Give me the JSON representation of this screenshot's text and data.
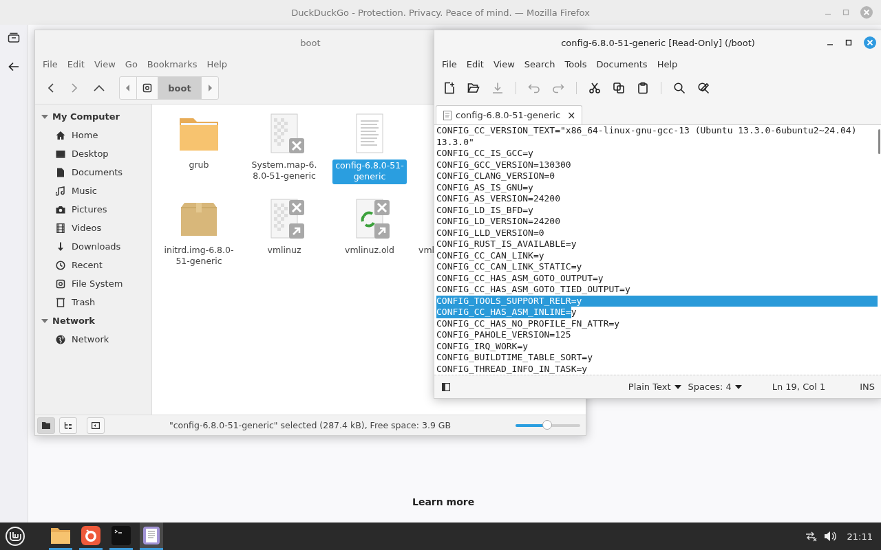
{
  "browser": {
    "title": "DuckDuckGo - Protection. Privacy. Peace of mind. — Mozilla Firefox",
    "learn_more": "Learn more"
  },
  "file_manager": {
    "title": "boot",
    "menu": [
      "File",
      "Edit",
      "View",
      "Go",
      "Bookmarks",
      "Help"
    ],
    "path": [
      {
        "kind": "drive",
        "selected": false
      },
      {
        "kind": "folder",
        "label": "boot",
        "selected": true
      }
    ],
    "sidebar": [
      {
        "label": "My Computer",
        "expanded": true,
        "children": [
          {
            "label": "Home",
            "kind": "home"
          },
          {
            "label": "Desktop",
            "kind": "desktop"
          },
          {
            "label": "Documents",
            "kind": "document"
          },
          {
            "label": "Music",
            "kind": "music"
          },
          {
            "label": "Pictures",
            "kind": "camera"
          },
          {
            "label": "Videos",
            "kind": "film"
          },
          {
            "label": "Downloads",
            "kind": "download"
          },
          {
            "label": "Recent",
            "kind": "clock"
          },
          {
            "label": "File System",
            "kind": "drive"
          },
          {
            "label": "Trash",
            "kind": "trash"
          }
        ]
      },
      {
        "label": "Network",
        "expanded": true,
        "children": [
          {
            "label": "Network",
            "kind": "globe"
          }
        ]
      }
    ],
    "files": [
      {
        "name": "grub",
        "kind": "folder",
        "selected": false
      },
      {
        "name": "System.map-6.8.0-51-generic",
        "kind": "broken",
        "selected": false
      },
      {
        "name": "config-6.8.0-51-generic",
        "kind": "text",
        "selected": true
      },
      {
        "name": "initrd.img-6.8.0-51-generic",
        "kind": "package",
        "selected": false
      },
      {
        "name": "vmlinuz",
        "kind": "broken-link",
        "selected": false
      },
      {
        "name": "vmlinuz.old",
        "kind": "recycle-link",
        "selected": false
      },
      {
        "name": "vml",
        "kind": "covered",
        "selected": false
      }
    ],
    "status": "\"config-6.8.0-51-generic\" selected (287.4 kB), Free space: 3.9 GB",
    "zoom": {
      "level": 0.49
    }
  },
  "editor": {
    "title": "config-6.8.0-51-generic [Read-Only] (/boot)",
    "menu": [
      "File",
      "Edit",
      "View",
      "Search",
      "Tools",
      "Documents",
      "Help"
    ],
    "toolbar": [
      {
        "kind": "new",
        "disabled": false
      },
      {
        "kind": "open",
        "disabled": false
      },
      {
        "kind": "save",
        "disabled": true
      },
      {
        "kind": "sep"
      },
      {
        "kind": "undo",
        "disabled": true
      },
      {
        "kind": "redo",
        "disabled": true
      },
      {
        "kind": "sep"
      },
      {
        "kind": "cut",
        "disabled": false
      },
      {
        "kind": "copy",
        "disabled": false
      },
      {
        "kind": "paste",
        "disabled": false
      },
      {
        "kind": "sep"
      },
      {
        "kind": "search",
        "disabled": false
      },
      {
        "kind": "replace",
        "disabled": false
      }
    ],
    "tab": {
      "label": "config-6.8.0-51-generic",
      "close": "×"
    },
    "lines": [
      {
        "segments": [
          {
            "text": "CONFIG_CC_VERSION_TEXT=\"x86_64-linux-gnu-gcc-13 (Ubuntu 13.3.0-6ubuntu2~24.04)",
            "selected": false
          }
        ],
        "eol_selected": false
      },
      {
        "segments": [
          {
            "text": "13.3.0\"",
            "selected": false
          }
        ],
        "eol_selected": false
      },
      {
        "segments": [
          {
            "text": "CONFIG_CC_IS_GCC=y",
            "selected": false
          }
        ],
        "eol_selected": false
      },
      {
        "segments": [
          {
            "text": "CONFIG_GCC_VERSION=130300",
            "selected": false
          }
        ],
        "eol_selected": false
      },
      {
        "segments": [
          {
            "text": "CONFIG_CLANG_VERSION=0",
            "selected": false
          }
        ],
        "eol_selected": false
      },
      {
        "segments": [
          {
            "text": "CONFIG_AS_IS_GNU=y",
            "selected": false
          }
        ],
        "eol_selected": false
      },
      {
        "segments": [
          {
            "text": "CONFIG_AS_VERSION=24200",
            "selected": false
          }
        ],
        "eol_selected": false
      },
      {
        "segments": [
          {
            "text": "CONFIG_LD_IS_BFD=y",
            "selected": false
          }
        ],
        "eol_selected": false
      },
      {
        "segments": [
          {
            "text": "CONFIG_LD_VERSION=24200",
            "selected": false
          }
        ],
        "eol_selected": false
      },
      {
        "segments": [
          {
            "text": "CONFIG_LLD_VERSION=0",
            "selected": false
          }
        ],
        "eol_selected": false
      },
      {
        "segments": [
          {
            "text": "CONFIG_RUST_IS_AVAILABLE=y",
            "selected": false
          }
        ],
        "eol_selected": false
      },
      {
        "segments": [
          {
            "text": "CONFIG_CC_CAN_LINK=y",
            "selected": false
          }
        ],
        "eol_selected": false
      },
      {
        "segments": [
          {
            "text": "CONFIG_CC_CAN_LINK_STATIC=y",
            "selected": false
          }
        ],
        "eol_selected": false
      },
      {
        "segments": [
          {
            "text": "CONFIG_CC_HAS_ASM_GOTO_OUTPUT=y",
            "selected": false
          }
        ],
        "eol_selected": false
      },
      {
        "segments": [
          {
            "text": "CONFIG_CC_HAS_ASM_GOTO_TIED_OUTPUT=y",
            "selected": false
          }
        ],
        "eol_selected": false
      },
      {
        "segments": [
          {
            "text": "CONFIG_TOOLS_SUPPORT_RELR=y",
            "selected": true
          }
        ],
        "eol_selected": true
      },
      {
        "segments": [
          {
            "text": "CONFIG_CC_HAS_ASM_INLINE=",
            "selected": true
          },
          {
            "text": "y",
            "selected": false
          }
        ],
        "eol_selected": false
      },
      {
        "segments": [
          {
            "text": "CONFIG_CC_HAS_NO_PROFILE_FN_ATTR=y",
            "selected": false
          }
        ],
        "eol_selected": false
      },
      {
        "segments": [
          {
            "text": "CONFIG_PAHOLE_VERSION=125",
            "selected": false
          }
        ],
        "eol_selected": false
      },
      {
        "segments": [
          {
            "text": "CONFIG_IRQ_WORK=y",
            "selected": false
          }
        ],
        "eol_selected": false
      },
      {
        "segments": [
          {
            "text": "CONFIG_BUILDTIME_TABLE_SORT=y",
            "selected": false
          }
        ],
        "eol_selected": false
      },
      {
        "segments": [
          {
            "text": "CONFIG_THREAD_INFO_IN_TASK=y",
            "selected": false
          }
        ],
        "eol_selected": false
      }
    ],
    "status": {
      "language": "Plain Text",
      "indent": "Spaces: 4",
      "position": "Ln 19, Col 1",
      "mode": "INS"
    }
  },
  "taskbar": {
    "apps": [
      {
        "kind": "files",
        "running": true,
        "selected": false
      },
      {
        "kind": "firefox",
        "running": true,
        "selected": false
      },
      {
        "kind": "terminal",
        "running": true,
        "selected": false
      },
      {
        "kind": "editor",
        "running": true,
        "selected": true
      }
    ],
    "clock": "21:11"
  }
}
